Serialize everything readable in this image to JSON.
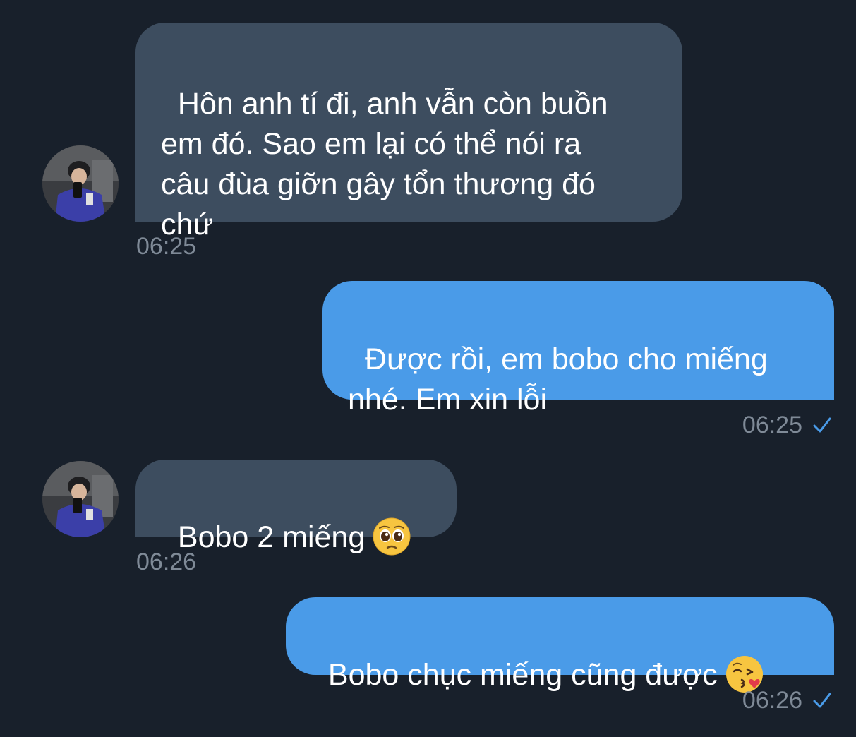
{
  "conversation": {
    "messages": [
      {
        "direction": "incoming",
        "text": "Hôn anh tí đi, anh vẫn còn buồn\nem đó. Sao em lại có thể nói ra\ncâu đùa giỡn gây tổn thương đó\nchứ",
        "time": "06:25",
        "avatar": "avatar-photo"
      },
      {
        "direction": "outgoing",
        "text": "Được rồi, em bobo cho miếng\nnhé. Em xin lỗi",
        "time": "06:25",
        "status_icon": "checkmark-icon"
      },
      {
        "direction": "incoming",
        "text": "Bobo 2 miếng",
        "emoji": "pleading-face-emoji",
        "time": "06:26",
        "avatar": "avatar-photo"
      },
      {
        "direction": "outgoing",
        "text": "Bobo chục miếng cũng được",
        "emoji": "face-blowing-kiss-emoji",
        "time": "06:26",
        "status_icon": "checkmark-icon"
      }
    ]
  },
  "colors": {
    "background": "#18202b",
    "incoming_bubble": "#3d4d5f",
    "outgoing_bubble": "#4a9be8",
    "timestamp": "#7f8a97",
    "check": "#4a9be8"
  }
}
